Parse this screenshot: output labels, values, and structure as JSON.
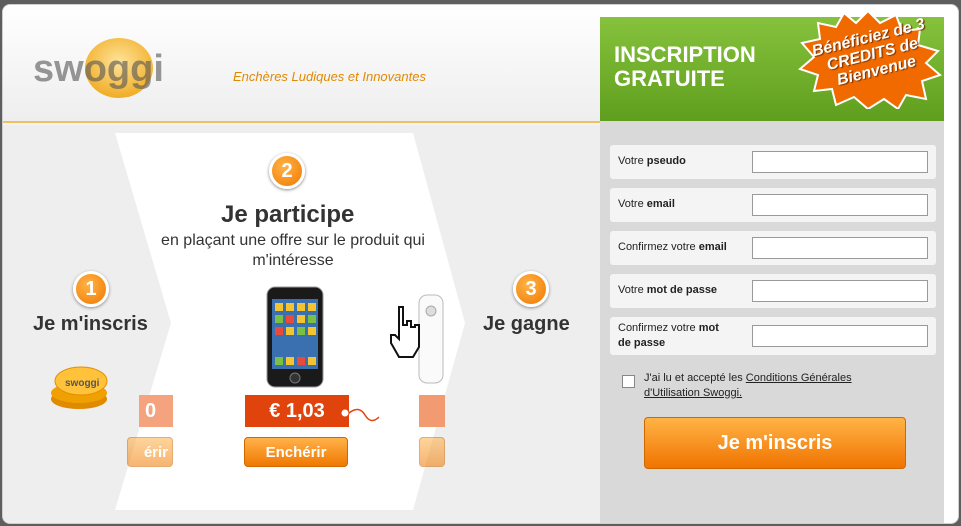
{
  "header": {
    "tagline": "Enchères Ludiques et Innovantes"
  },
  "steps": [
    {
      "number": "1",
      "title": "Je m'inscris"
    },
    {
      "number": "2",
      "title": "Je participe",
      "subtitle": "en plaçant une offre sur le produit qui m'intéresse"
    },
    {
      "number": "3",
      "title": "Je gagne"
    }
  ],
  "auctions": {
    "price_main": "€ 1,03",
    "price_left_partial": "0",
    "bid_label": "Enchérir",
    "bid_left_partial": "érir"
  },
  "signup": {
    "title": "INSCRIPTION GRATUITE",
    "promo": "Bénéficiez de 3 CREDITS de Bienvenue",
    "fields": [
      {
        "label_pre": "Votre ",
        "label_bold": "pseudo"
      },
      {
        "label_pre": "Votre ",
        "label_bold": "email"
      },
      {
        "label_pre": "Confirmez votre ",
        "label_bold": "email"
      },
      {
        "label_pre": "Votre ",
        "label_bold": "mot de passe"
      },
      {
        "label_pre": "Confirmez votre ",
        "label_bold": "mot de passe"
      }
    ],
    "terms_pre": "J'ai lu et accepté les ",
    "terms_link": "Conditions Générales d'Utilisation Swoggi.",
    "submit_label": "Je m'inscris"
  },
  "colors": {
    "accent_orange": "#f07800",
    "price_red": "#e0440c",
    "green": "#6aa828"
  },
  "icons": [
    "swoggi-logo",
    "coins-icon",
    "iphone-image",
    "wii-remote-image",
    "hand-cursor-icon",
    "price-tag-icon"
  ]
}
